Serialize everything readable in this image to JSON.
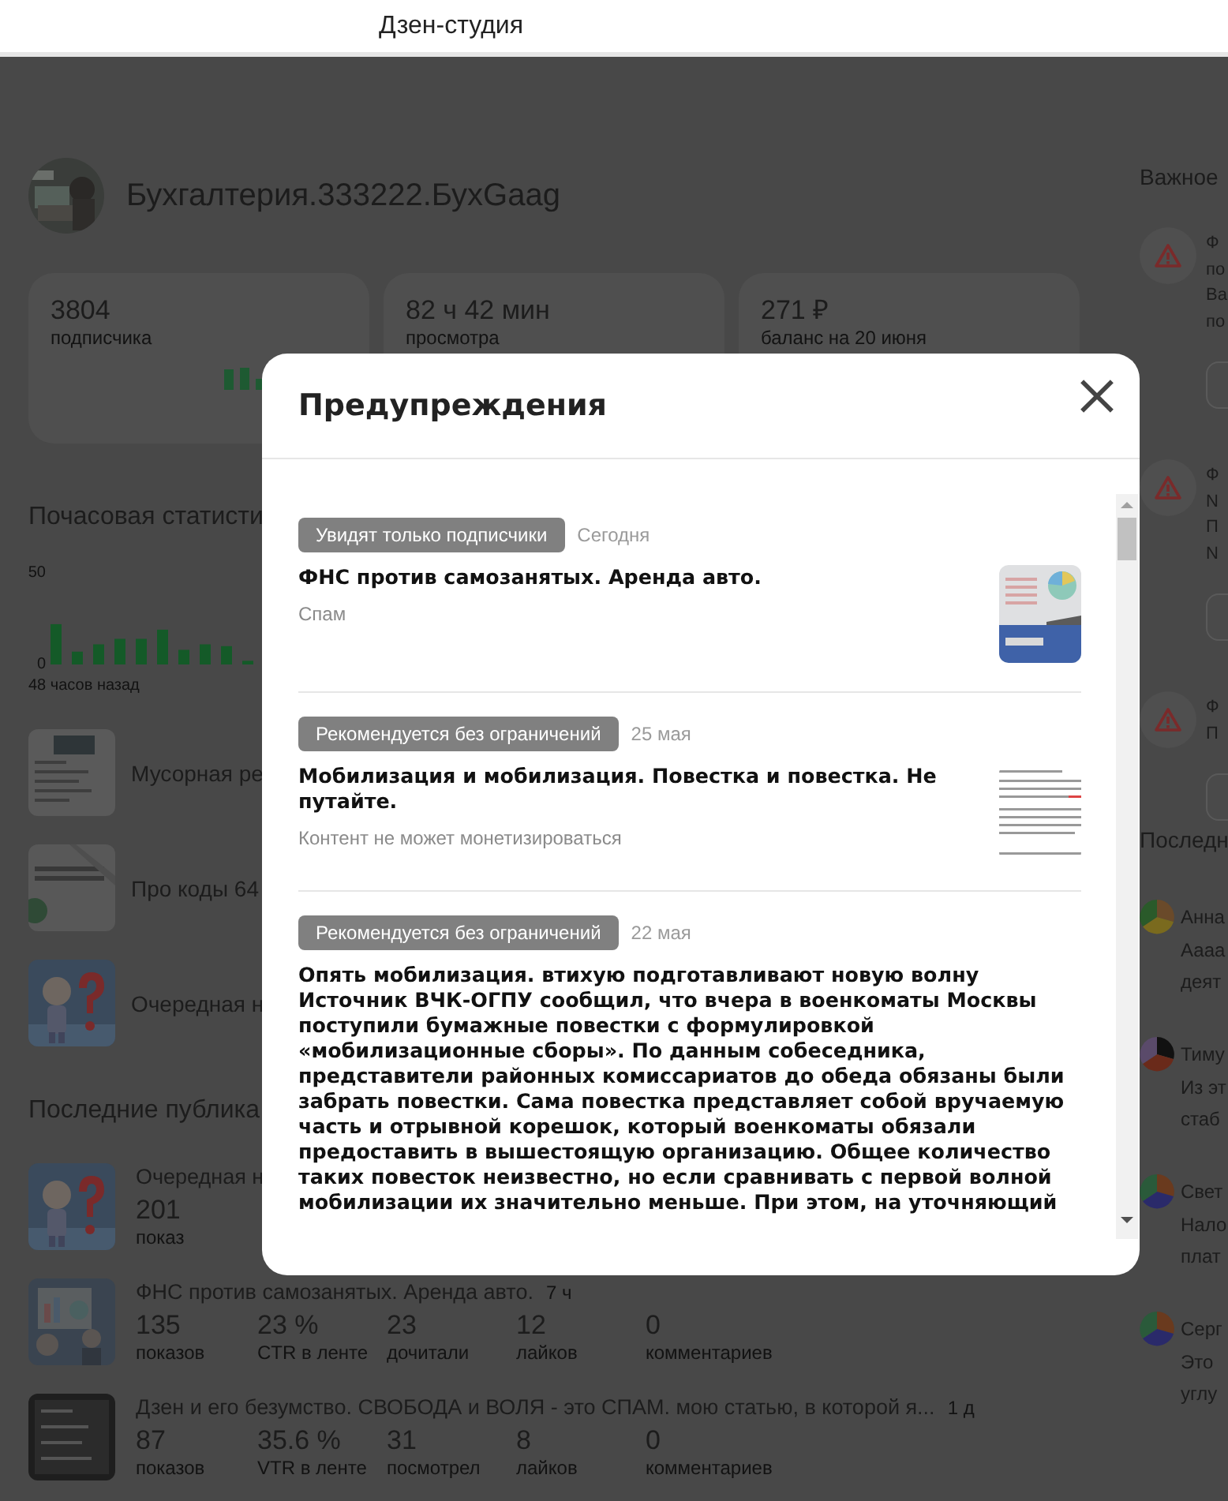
{
  "app_bar": {
    "title": "Дзен-студия"
  },
  "channel": {
    "name": "Бухгалтерия.333222.БухGaag"
  },
  "stats": [
    {
      "value": "3804",
      "label": "подписчика",
      "kind": "sparkline"
    },
    {
      "value": "82 ч 42 мин",
      "label": "просмотра",
      "kind": "plain"
    },
    {
      "value": "271 ₽",
      "label": "баланс на 20 июня",
      "kind": "plain"
    }
  ],
  "hourly": {
    "title": "Почасовая статисти",
    "axis_max": "50",
    "axis_min": "0",
    "caption": "48 часов назад"
  },
  "popular": [
    {
      "title": "Мусорная ре"
    },
    {
      "title": "Про коды 64"
    },
    {
      "title": "Очередная н"
    }
  ],
  "recent": {
    "title": "Последние публика",
    "items": [
      {
        "title": "Очередная н",
        "stats": [
          {
            "value": "201",
            "label": "показ"
          }
        ]
      },
      {
        "title": "ФНС против самозанятых. Аренда авто.",
        "age": "7 ч",
        "stats": [
          {
            "value": "135",
            "label": "показов"
          },
          {
            "value": "23 %",
            "label": "CTR в ленте"
          },
          {
            "value": "23",
            "label": "дочитали"
          },
          {
            "value": "12",
            "label": "лайков"
          },
          {
            "value": "0",
            "label": "комментариев"
          }
        ]
      },
      {
        "title": "Дзен и его безумство. СВОБОДА и ВОЛЯ - это СПАМ. мою статью, в которой я...",
        "age": "1 д",
        "stats": [
          {
            "value": "87",
            "label": "показов"
          },
          {
            "value": "35.6 %",
            "label": "VTR в ленте"
          },
          {
            "value": "31",
            "label": "посмотрел"
          },
          {
            "value": "8",
            "label": "лайков"
          },
          {
            "value": "0",
            "label": "комментариев"
          }
        ]
      }
    ]
  },
  "important": {
    "title": "Важное",
    "items": [
      {
        "lines": [
          "Ф",
          "по",
          "Ва",
          "по"
        ]
      },
      {
        "lines": [
          "Ф",
          "N",
          "П",
          "N"
        ]
      },
      {
        "lines": [
          "Ф",
          "П"
        ]
      }
    ]
  },
  "comments": {
    "title": "Последн",
    "items": [
      {
        "name": "Анна",
        "lines": [
          "Аааа",
          "деят"
        ]
      },
      {
        "name": "Тиму",
        "lines": [
          "Из эт",
          "стаб"
        ]
      },
      {
        "name": "Свет",
        "lines": [
          "Нало",
          "плат"
        ]
      },
      {
        "name": "Серг",
        "lines": [
          "Это",
          "углу"
        ]
      }
    ]
  },
  "modal": {
    "title": "Предупреждения",
    "items": [
      {
        "tag": "Увидят только подписчики",
        "date": "Сегодня",
        "title": "ФНС против самозанятых. Аренда авто.",
        "reason": "Спам",
        "kind": "picture"
      },
      {
        "tag": "Рекомендуется без ограничений",
        "date": "25 мая",
        "title": "Мобилизация и мобилизация. Повестка и повестка. Не путайте.",
        "reason": "Контент не может монетизироваться",
        "kind": "picture"
      },
      {
        "tag": "Рекомендуется без ограничений",
        "date": "22 мая",
        "title": "Опять мобилизация. втихую подготавливают новую волну Источник ВЧК-ОГПУ сообщил, что вчера в военкоматы Москвы поступили бумажные повестки с формулировкой «мобилизационные сборы». По данным собеседника, представители районных комиссариатов до обеда обязаны были забрать повестки. Сама повестка представляет собой вручаемую часть и отрывной корешок, который военкоматы обязали предоставить в вышестоящую организацию. Общее количество таких повесток неизвестно, но если сравнивать с первой волной мобилизации их значительно меньше. При этом, на уточняющий"
      }
    ]
  }
}
